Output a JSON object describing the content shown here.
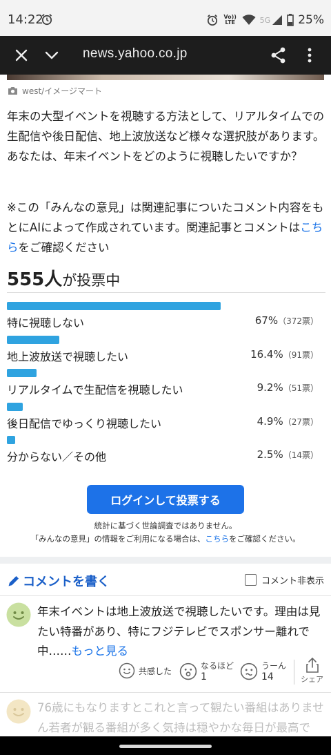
{
  "status_bar": {
    "time": "14:22",
    "network_label": "Vo)) LTE",
    "network_5g": "5G",
    "battery": "25%"
  },
  "browser": {
    "url": "news.yahoo.co.jp"
  },
  "article": {
    "photo_credit": "west/イメージマート",
    "paragraph1": "年末の大型イベントを視聴する方法として、リアルタイムでの生配信や後日配信、地上波放送など様々な選択肢があります。あなたは、年末イベントをどのように視聴したいですか？",
    "paragraph2_prefix": "※この「みんなの意見」は関連記事についたコメント内容をもとにAIによって作成されています。関連記事とコメントは",
    "paragraph2_link": "こちら",
    "paragraph2_suffix": "をご確認ください"
  },
  "poll": {
    "voter_count": "555人",
    "voter_suffix": "が投票中",
    "options": [
      {
        "label": "特に視聴しない",
        "percent": "67%",
        "votes": "（372票）",
        "share": 0.67
      },
      {
        "label": "地上波放送で視聴したい",
        "percent": "16.4%",
        "votes": "（91票）",
        "share": 0.164
      },
      {
        "label": "リアルタイムで生配信を視聴したい",
        "percent": "9.2%",
        "votes": "（51票）",
        "share": 0.092
      },
      {
        "label": "後日配信でゆっくり視聴したい",
        "percent": "4.9%",
        "votes": "（27票）",
        "share": 0.049
      },
      {
        "label": "分からない／その他",
        "percent": "2.5%",
        "votes": "（14票）",
        "share": 0.025
      }
    ],
    "login_button": "ログインして投票する",
    "note1": "統計に基づく世論調査ではありません。",
    "note2_prefix": "「みんなの意見」の情報をご利用になる場合は、",
    "note2_link": "こちら",
    "note2_suffix": "をご確認ください。",
    "bar_color": "#2fa3e0"
  },
  "comments": {
    "write_label": "コメントを書く",
    "hide_label": "コメント非表示",
    "items": [
      {
        "text": "年末イベントは地上波放送で視聴したいです。理由は見たい特番があり、特にフジテレビでスポンサー離れで中……",
        "more_link": "もっと見る",
        "reactions": {
          "empathy_label": "共感した",
          "insight_label": "なるほど",
          "insight_count": "1",
          "hmm_label": "うーん",
          "hmm_count": "14",
          "share_label": "シェア"
        }
      },
      {
        "text": "76歳にもなりますとこれと言って観たい番組はありませ\nん若者が観る番組が多く気持は穏やかな毎日が最高で"
      }
    ]
  },
  "accent_color": "#1d72e8"
}
